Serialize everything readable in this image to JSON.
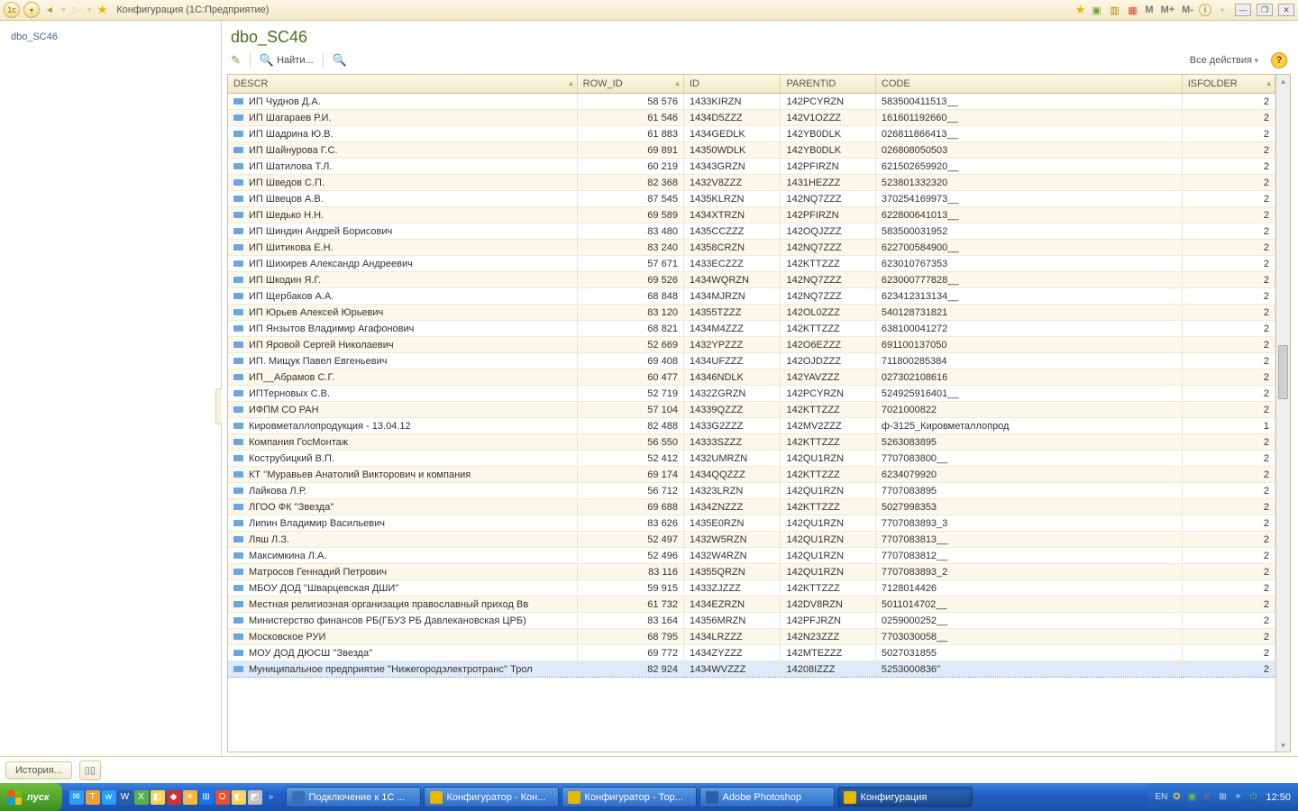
{
  "window": {
    "title": "Конфигурация  (1С:Предприятие)",
    "tb_right": {
      "m": "M",
      "mp": "M+",
      "mm": "M-"
    }
  },
  "nav": {
    "item1": "dbo_SC46"
  },
  "page": {
    "title": "dbo_SC46",
    "find_label": "Найти...",
    "all_actions": "Все действия"
  },
  "columns": {
    "descr": "DESCR",
    "rowid": "ROW_ID",
    "id": "ID",
    "parentid": "PARENTID",
    "code": "CODE",
    "isfolder": "ISFOLDER"
  },
  "rows": [
    {
      "descr": "ИП Чуднов Д.А.",
      "rowid": "58 576",
      "id": "1433KIRZN",
      "parentid": "142PCYRZN",
      "code": "583500411513__",
      "isfolder": "2"
    },
    {
      "descr": "ИП Шагараев Р.И.",
      "rowid": "61 546",
      "id": "1434D5ZZZ",
      "parentid": "142V1OZZZ",
      "code": "161601192660__",
      "isfolder": "2"
    },
    {
      "descr": "ИП Шадрина Ю.В.",
      "rowid": "61 883",
      "id": "1434GEDLK",
      "parentid": "142YB0DLK",
      "code": "026811866413__",
      "isfolder": "2"
    },
    {
      "descr": "ИП Шайнурова Г.С.",
      "rowid": "69 891",
      "id": "14350WDLK",
      "parentid": "142YB0DLK",
      "code": "026808050503",
      "isfolder": "2"
    },
    {
      "descr": "ИП Шатилова Т.Л.",
      "rowid": "60 219",
      "id": "14343GRZN",
      "parentid": "142PFIRZN",
      "code": "621502659920__",
      "isfolder": "2"
    },
    {
      "descr": "ИП Шведов С.П.",
      "rowid": "82 368",
      "id": "1432V8ZZZ",
      "parentid": "1431HEZZZ",
      "code": "523801332320",
      "isfolder": "2"
    },
    {
      "descr": "ИП Швецов А.В.",
      "rowid": "87 545",
      "id": "1435KLRZN",
      "parentid": "142NQ7ZZZ",
      "code": "370254169973__",
      "isfolder": "2"
    },
    {
      "descr": "ИП Шедько Н.Н.",
      "rowid": "69 589",
      "id": "1434XTRZN",
      "parentid": "142PFIRZN",
      "code": "622800641013__",
      "isfolder": "2"
    },
    {
      "descr": "ИП Шиндин Андрей Борисович",
      "rowid": "83 480",
      "id": "1435CCZZZ",
      "parentid": "142OQJZZZ",
      "code": "583500031952",
      "isfolder": "2"
    },
    {
      "descr": "ИП Шитикова Е.Н.",
      "rowid": "83 240",
      "id": "14358CRZN",
      "parentid": "142NQ7ZZZ",
      "code": "622700584900__",
      "isfolder": "2"
    },
    {
      "descr": "ИП Шихирев Александр Андреевич",
      "rowid": "57 671",
      "id": "1433ECZZZ",
      "parentid": "142KTTZZZ",
      "code": "623010767353",
      "isfolder": "2"
    },
    {
      "descr": "ИП Шкодин Я.Г.",
      "rowid": "69 526",
      "id": "1434WQRZN",
      "parentid": "142NQ7ZZZ",
      "code": "623000777828__",
      "isfolder": "2"
    },
    {
      "descr": "ИП Щербаков А.А.",
      "rowid": "68 848",
      "id": "1434MJRZN",
      "parentid": "142NQ7ZZZ",
      "code": "623412313134__",
      "isfolder": "2"
    },
    {
      "descr": "ИП Юрьев Алексей Юрьевич",
      "rowid": "83 120",
      "id": "14355TZZZ",
      "parentid": "142OL0ZZZ",
      "code": "540128731821",
      "isfolder": "2"
    },
    {
      "descr": "ИП Янзытов Владимир Агафонович",
      "rowid": "68 821",
      "id": "1434M4ZZZ",
      "parentid": "142KTTZZZ",
      "code": "638100041272",
      "isfolder": "2"
    },
    {
      "descr": "ИП Яровой Сергей Николаевич",
      "rowid": "52 669",
      "id": "1432YPZZZ",
      "parentid": "142O6EZZZ",
      "code": "691100137050",
      "isfolder": "2"
    },
    {
      "descr": "ИП. Мищук Павел Евгеньевич",
      "rowid": "69 408",
      "id": "1434UFZZZ",
      "parentid": "142OJDZZZ",
      "code": "711800285384",
      "isfolder": "2"
    },
    {
      "descr": "ИП__Абрамов С.Г.",
      "rowid": "60 477",
      "id": "14346NDLK",
      "parentid": "142YAVZZZ",
      "code": "027302108616",
      "isfolder": "2"
    },
    {
      "descr": "ИПТерновых С.В.",
      "rowid": "52 719",
      "id": "1432ZGRZN",
      "parentid": "142PCYRZN",
      "code": "524925916401__",
      "isfolder": "2"
    },
    {
      "descr": "ИФПМ СО РАН",
      "rowid": "57 104",
      "id": "14339QZZZ",
      "parentid": "142KTTZZZ",
      "code": "7021000822",
      "isfolder": "2"
    },
    {
      "descr": "Кировметаллопродукция - 13.04.12",
      "rowid": "82 488",
      "id": "1433G2ZZZ",
      "parentid": "142MV2ZZZ",
      "code": "ф-3125_Кировметаллопрод",
      "isfolder": "1"
    },
    {
      "descr": "Компания ГосМонтаж",
      "rowid": "56 550",
      "id": "14333SZZZ",
      "parentid": "142KTTZZZ",
      "code": "5263083895",
      "isfolder": "2"
    },
    {
      "descr": "Кострубицкий  В.П.",
      "rowid": "52 412",
      "id": "1432UMRZN",
      "parentid": "142QU1RZN",
      "code": "7707083800__",
      "isfolder": "2"
    },
    {
      "descr": "КТ ''Муравьев Анатолий Викторович и компания",
      "rowid": "69 174",
      "id": "1434QQZZZ",
      "parentid": "142KTTZZZ",
      "code": "6234079920",
      "isfolder": "2"
    },
    {
      "descr": "Лайкова  Л.Р.",
      "rowid": "56 712",
      "id": "14323LRZN",
      "parentid": "142QU1RZN",
      "code": "7707083895",
      "isfolder": "2"
    },
    {
      "descr": "ЛГОО ФК ''Звезда''",
      "rowid": "69 688",
      "id": "1434ZNZZZ",
      "parentid": "142KTTZZZ",
      "code": "5027998353",
      "isfolder": "2"
    },
    {
      "descr": "Липин Владимир Васильевич",
      "rowid": "83 626",
      "id": "1435E0RZN",
      "parentid": "142QU1RZN",
      "code": "7707083893_3",
      "isfolder": "2"
    },
    {
      "descr": "Ляш Л.З.",
      "rowid": "52 497",
      "id": "1432W5RZN",
      "parentid": "142QU1RZN",
      "code": "7707083813__",
      "isfolder": "2"
    },
    {
      "descr": "Максимкина Л.А.",
      "rowid": "52 496",
      "id": "1432W4RZN",
      "parentid": "142QU1RZN",
      "code": "7707083812__",
      "isfolder": "2"
    },
    {
      "descr": "Матросов Геннадий Петрович",
      "rowid": "83 116",
      "id": "14355QRZN",
      "parentid": "142QU1RZN",
      "code": "7707083893_2",
      "isfolder": "2"
    },
    {
      "descr": "МБОУ ДОД ''Шварцевская ДШИ''",
      "rowid": "59 915",
      "id": "1433ZJZZZ",
      "parentid": "142KTTZZZ",
      "code": "7128014426",
      "isfolder": "2"
    },
    {
      "descr": "Местная религиозная организация православный приход Вв",
      "rowid": "61 732",
      "id": "1434EZRZN",
      "parentid": "142DV8RZN",
      "code": "5011014702__",
      "isfolder": "2"
    },
    {
      "descr": "Министерство финансов РБ(ГБУЗ РБ Давлекановская ЦРБ)",
      "rowid": "83 164",
      "id": "14356MRZN",
      "parentid": "142PFJRZN",
      "code": "0259000252__",
      "isfolder": "2"
    },
    {
      "descr": "Московское РУИ",
      "rowid": "68 795",
      "id": "1434LRZZZ",
      "parentid": "142N23ZZZ",
      "code": "7703030058__",
      "isfolder": "2"
    },
    {
      "descr": "МОУ ДОД ДЮСШ ''Звезда''",
      "rowid": "69 772",
      "id": "1434ZYZZZ",
      "parentid": "142MTEZZZ",
      "code": "5027031855",
      "isfolder": "2"
    },
    {
      "descr": "Муниципальное предприятие ''Нижегородэлектротранс'' Трол",
      "rowid": "82 924",
      "id": "1434WVZZZ",
      "parentid": "14208IZZZ",
      "code": "5253000836''",
      "isfolder": "2",
      "selected": true
    }
  ],
  "statusbar": {
    "history": "История..."
  },
  "taskbar": {
    "start": "пуск",
    "tasks": [
      {
        "label": "Подключение к 1С ...",
        "icon": "#3b6fb5"
      },
      {
        "label": "Конфигуратор - Кон...",
        "icon": "#e6b800"
      },
      {
        "label": "Конфигуратор - Тор...",
        "icon": "#e6b800"
      },
      {
        "label": "Adobe Photoshop",
        "icon": "#2a5fa5"
      },
      {
        "label": "Конфигурация",
        "icon": "#e6b800",
        "active": true
      }
    ],
    "lang": "EN",
    "clock": "12:50"
  }
}
